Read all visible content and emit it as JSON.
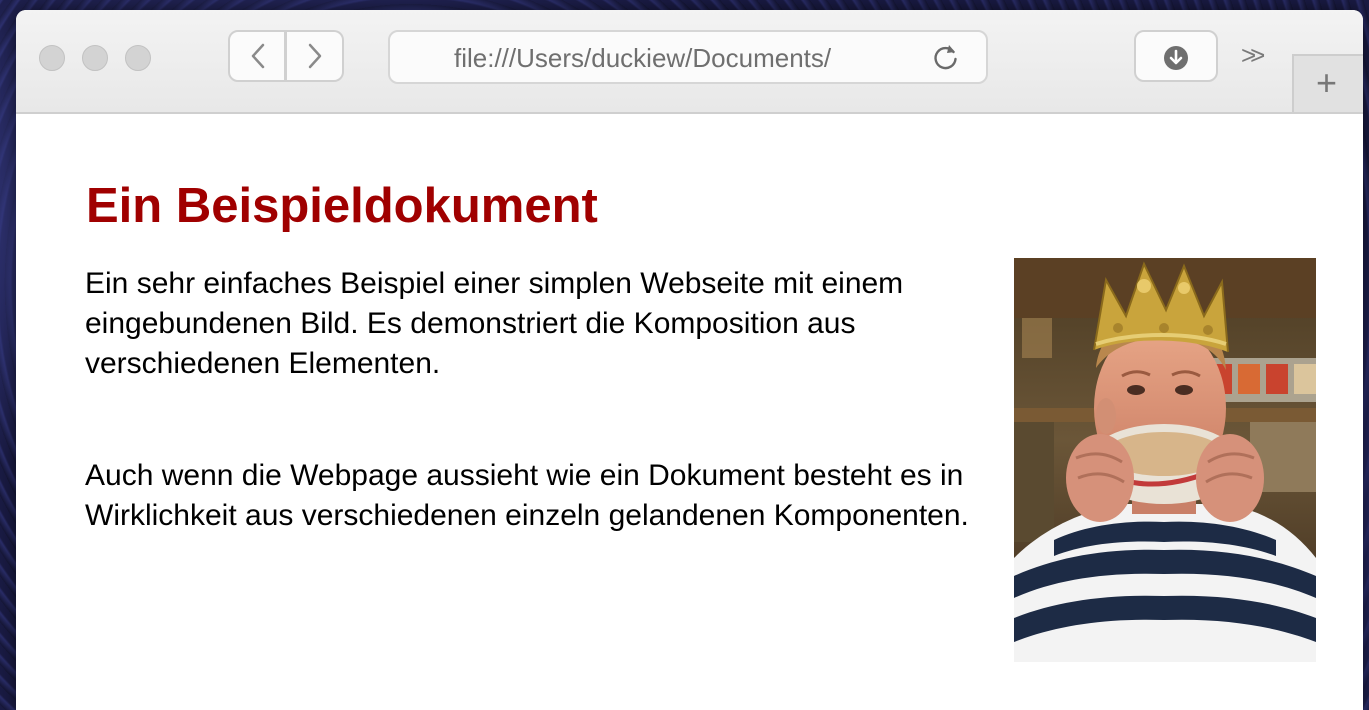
{
  "browser": {
    "url": "file:///Users/duckiew/Documents/",
    "overflow_label": ">>",
    "new_tab_label": "+",
    "colors": {
      "chrome_bg": "#ececec",
      "border": "#cfcfcf"
    }
  },
  "icons": {
    "back": "chevron-left-icon",
    "forward": "chevron-right-icon",
    "reload": "reload-icon",
    "download": "download-icon"
  },
  "page": {
    "title": "Ein Beispieldokument",
    "paragraphs": [
      "Ein sehr einfaches Beispiel einer simplen Webseite mit einem eingebundenen Bild. Es demonstriert die Komposition aus verschiedenen Elementen.",
      "Auch wenn die Webpage aussieht wie ein Dokument besteht es in Wirklichkeit aus verschiedenen einzeln gelandenen Komponenten."
    ],
    "title_color": "#a00000"
  }
}
